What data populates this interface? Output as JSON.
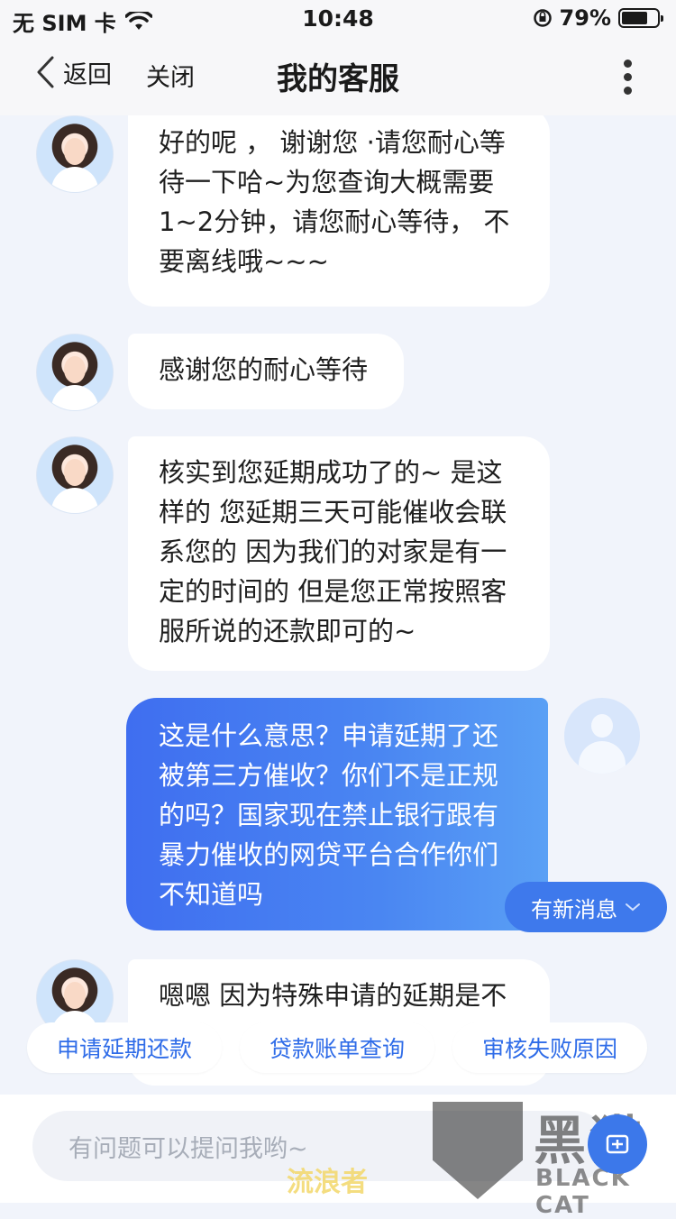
{
  "status_bar": {
    "carrier": "无 SIM 卡",
    "time": "10:48",
    "battery_percent": "79%",
    "battery_level": 0.79
  },
  "nav": {
    "back_label": "返回",
    "close_label": "关闭",
    "title": "我的客服"
  },
  "messages": [
    {
      "from": "agent",
      "text": "好的呢 ， 谢谢您 ·请您耐心等待一下哈~为您查询大概需要1~2分钟，请您耐心等待， 不要离线哦~~~"
    },
    {
      "from": "agent",
      "text": "感谢您的耐心等待"
    },
    {
      "from": "agent",
      "text": "核实到您延期成功了的~ 是这样的 您延期三天可能催收会联系您的 因为我们的对家是有一定的时间的 但是您正常按照客服所说的还款即可的~"
    },
    {
      "from": "user",
      "text": "这是什么意思？申请延期了还被第三方催收？你们不是正规的吗？国家现在禁止银行跟有暴力催收的网贷平台合作你们不知道吗"
    },
    {
      "from": "agent",
      "text": "嗯嗯 因为特殊申请的延期是不"
    }
  ],
  "new_message_label": "有新消息",
  "quick_replies": [
    "申请延期还款",
    "贷款账单查询",
    "审核失败原因"
  ],
  "input": {
    "placeholder": "有问题可以提问我哟~"
  },
  "watermarks": {
    "overlay_text": "流浪者",
    "brand_cn": "黑猫",
    "brand_en": "BLACK CAT"
  },
  "colors": {
    "accent": "#3e79ec",
    "chip_text": "#2f6ce8",
    "background": "#f1f4fb"
  }
}
